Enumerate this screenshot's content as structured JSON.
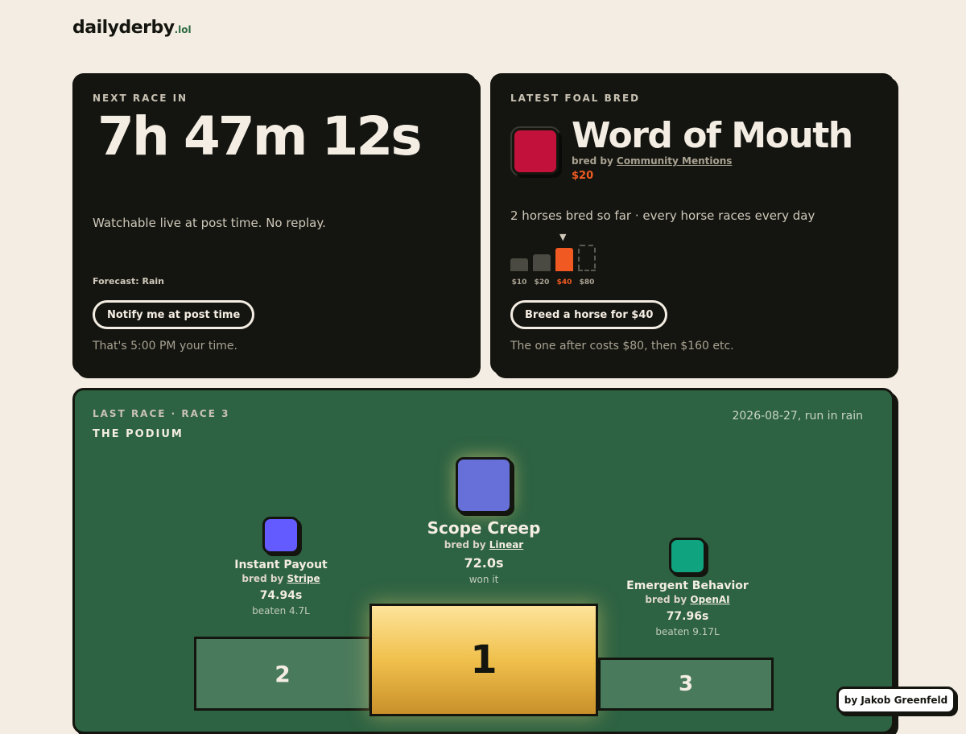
{
  "logo": {
    "name": "dailyderby",
    "tld": ".lol"
  },
  "next_race": {
    "eyebrow": "NEXT RACE IN",
    "countdown": "7h 47m 12s",
    "watch_note": "Watchable live at post time. No replay.",
    "forecast": "Forecast: Rain",
    "notify_button": "Notify me at post time",
    "local_time_note": "That's 5:00 PM your time."
  },
  "latest_foal": {
    "eyebrow": "LATEST FOAL BRED",
    "name": "Word of Mouth",
    "bred_by_prefix": "bred by",
    "breeder": "Community Mentions",
    "price": "$20",
    "swatch_color": "#c2123b",
    "summary": "2 horses bred so far · every horse races every day",
    "price_steps": [
      {
        "label": "$10",
        "state": "filled"
      },
      {
        "label": "$20",
        "state": "filled"
      },
      {
        "label": "$40",
        "state": "current"
      },
      {
        "label": "$80",
        "state": "future"
      }
    ],
    "current_marker": "▼",
    "breed_button": "Breed a horse for $40",
    "next_cost_note": "The one after costs $80, then $160 etc."
  },
  "last_race": {
    "eyebrow": "LAST RACE · RACE 3",
    "heading": "THE PODIUM",
    "date_note": "2026-08-27, run in rain",
    "bred_by_prefix": "bred by",
    "first": {
      "name": "Scope Creep",
      "breeder": "Linear",
      "time": "72.0s",
      "note": "won it",
      "place": "1",
      "color": "#6670d8"
    },
    "second": {
      "name": "Instant Payout",
      "breeder": "Stripe",
      "time": "74.94s",
      "note": "beaten 4.7L",
      "place": "2",
      "color": "#635bff"
    },
    "third": {
      "name": "Emergent Behavior",
      "breeder": "OpenAI",
      "time": "77.96s",
      "note": "beaten 9.17L",
      "place": "3",
      "color": "#10a37f"
    }
  },
  "credit": "by Jakob Greenfeld",
  "colors": {
    "background": "#f4ede3",
    "card": "#141510",
    "accent": "#f05a22",
    "podium": "#2d6242",
    "gold": "#f0c04c"
  }
}
